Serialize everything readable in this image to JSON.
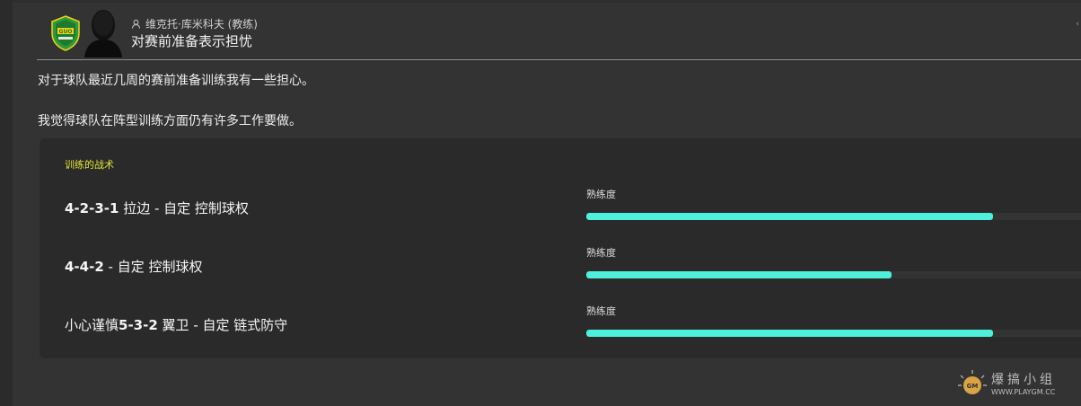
{
  "message": {
    "sender": "维克托·库米科夫 (教练)",
    "subject": "对赛前准备表示担忧",
    "corner_text": "‹",
    "body": [
      "对于球队最近几周的赛前准备训练我有一些担心。",
      "我觉得球队在阵型训练方面仍有许多工作要做。"
    ]
  },
  "panel": {
    "title": "训练的战术",
    "rows": [
      {
        "formation": "4-2-3-1",
        "desc": " 拉边 - 自定 控制球权",
        "prefix": "",
        "label": "熟练度",
        "familiarity": 0.8
      },
      {
        "formation": "4-4-2",
        "desc": " - 自定 控制球权",
        "prefix": "",
        "label": "熟练度",
        "familiarity": 0.6
      },
      {
        "formation": "5-3-2",
        "desc": " 翼卫 - 自定 链式防守",
        "prefix": "小心谨慎",
        "label": "熟练度",
        "familiarity": 0.8
      }
    ]
  },
  "watermark": {
    "cn": "爆搞小组",
    "url": "WWW.PLAYGM.CC"
  },
  "colors": {
    "accent_bar": "#4ef0dc",
    "panel_title": "#e6e23a",
    "badge_green": "#2f9a3a",
    "badge_yellow": "#f2d21a"
  }
}
